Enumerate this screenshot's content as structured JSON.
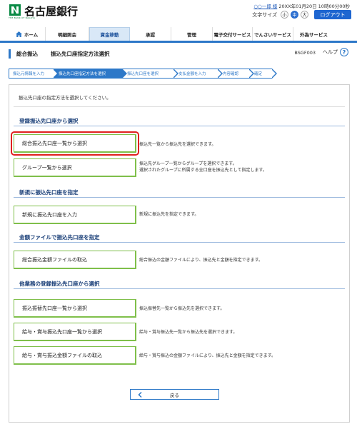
{
  "header": {
    "bank_name": "名古屋銀行",
    "logo_subtext": "THE BANK OF NAGOYA",
    "user_name": "○○一郎 様",
    "login_time": "20XX年01月20日 10時00分00秒",
    "font_size_label": "文字サイズ",
    "font_sizes": [
      "小",
      "中",
      "大"
    ],
    "logout_label": "ログアウト"
  },
  "nav": {
    "items": [
      {
        "label": "ホーム"
      },
      {
        "label": "明細照会"
      },
      {
        "label": "資金移動"
      },
      {
        "label": "承認"
      },
      {
        "label": "管理"
      },
      {
        "label": "電子交付サービス"
      },
      {
        "label": "でんさいサービス"
      },
      {
        "label": "外為サービス"
      }
    ]
  },
  "page": {
    "title": "総合振込",
    "subtitle": "振込先口座指定方法選択",
    "screen_id": "BSGF003",
    "help_label": "ヘルプ",
    "help_icon": "?"
  },
  "steps": [
    {
      "label": "振込元情報を入力"
    },
    {
      "label": "振込先口座指定方法を選択"
    },
    {
      "label": "振込先口座を選択"
    },
    {
      "label": "支払金額を入力"
    },
    {
      "label": "内容確認"
    },
    {
      "label": "確定"
    }
  ],
  "instruction": "振込先口座の指定方法を選択してください。",
  "sections": [
    {
      "heading": "登録振込先口座から選択",
      "options": [
        {
          "button": "総合振込先口座一覧から選択",
          "description": "振込先一覧から振込先を選択できます。"
        },
        {
          "button": "グループ一覧から選択",
          "description": "振込先グループ一覧からグループを選択できます。",
          "description2": "選択されたグループに所属する全口座を振込先として指定します。"
        }
      ]
    },
    {
      "heading": "新規に振込先口座を指定",
      "options": [
        {
          "button": "新規に振込先口座を入力",
          "description": "新規に振込先を指定できます。"
        }
      ]
    },
    {
      "heading": "金額ファイルで振込先口座を指定",
      "options": [
        {
          "button": "総合振込金額ファイルの取込",
          "description": "総合振込の金額ファイルにより、振込先と金額を指定できます。"
        }
      ]
    },
    {
      "heading": "他業務の登録振込先口座から選択",
      "options": [
        {
          "button": "振込振替先口座一覧から選択",
          "description": "振込振替先一覧から振込先を選択できます。"
        },
        {
          "button": "給与・賞与振込先口座一覧から選択",
          "description": "給与・賞与振込先一覧から振込先を選択できます。"
        },
        {
          "button": "給与・賞与振込金額ファイルの取込",
          "description": "給与・賞与振込の金額ファイルにより、振込先と金額を指定できます。"
        }
      ]
    }
  ],
  "back_label": "戻る",
  "colors": {
    "accent": "#2d78c8",
    "button_border": "#7fbf4a",
    "highlight": "#e02020",
    "logout": "#1e66d0"
  }
}
